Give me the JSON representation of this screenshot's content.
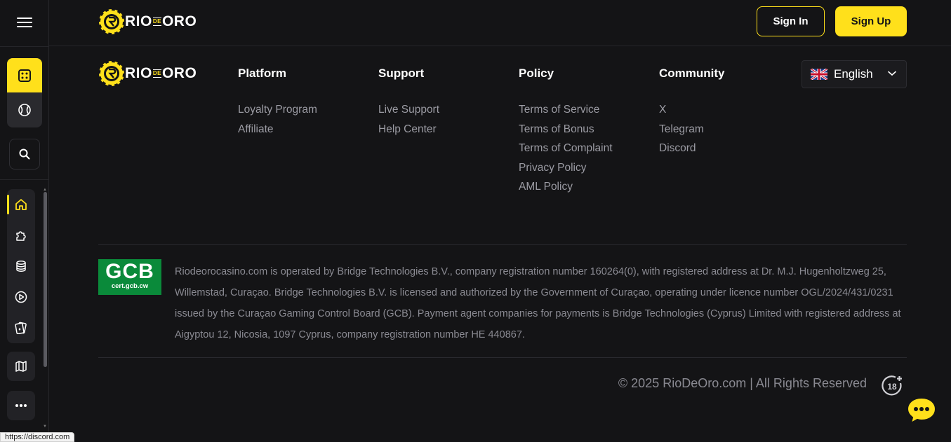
{
  "brand": {
    "part1": "RIO",
    "part2": "DE",
    "part3": "ORO",
    "accent": "#ffe01b",
    "background": "#141416"
  },
  "header": {
    "signin_label": "Sign In",
    "signup_label": "Sign Up"
  },
  "sidebar": {
    "icons": [
      "menu-icon",
      "casino-dice-icon",
      "sports-ball-icon",
      "search-icon",
      "home-icon",
      "puzzle-icon",
      "coins-stack-icon",
      "play-circle-icon",
      "cards-icon",
      "map-icon",
      "more-icon"
    ]
  },
  "footer": {
    "columns": [
      {
        "title": "Platform",
        "links": [
          "Loyalty Program",
          "Affiliate"
        ]
      },
      {
        "title": "Support",
        "links": [
          "Live Support",
          "Help Center"
        ]
      },
      {
        "title": "Policy",
        "links": [
          "Terms of Service",
          "Terms of Bonus",
          "Terms of Complaint",
          "Privacy Policy",
          "AML Policy"
        ]
      },
      {
        "title": "Community",
        "links": [
          "X",
          "Telegram",
          "Discord"
        ]
      }
    ],
    "language": {
      "selected": "English",
      "flag": "uk-flag-icon"
    },
    "gcb": {
      "title": "GCB",
      "subtitle": "cert.gcb.cw"
    },
    "license_text": "Riodeorocasino.com is operated by Bridge Technologies B.V., company registration number 160264(0), with registered address at Dr. M.J. Hugenholtzweg 25, Willemstad, Curaçao. Bridge Technologies B.V. is licensed and authorized by the Government of Curaçao, operating under licence number OGL/2024/431/0231 issued by the Curaçao Gaming Control Board (GCB). Payment agent companies for payments is Bridge Technologies (Cyprus) Limited with registered address at Aigyptou 12, Nicosia, 1097 Cyprus, company registration number HE 440867.",
    "copyright": "© 2025 RioDeOro.com | All Rights Reserved",
    "age_badge": "18+"
  },
  "status_bar": {
    "url": "https://discord.com"
  }
}
